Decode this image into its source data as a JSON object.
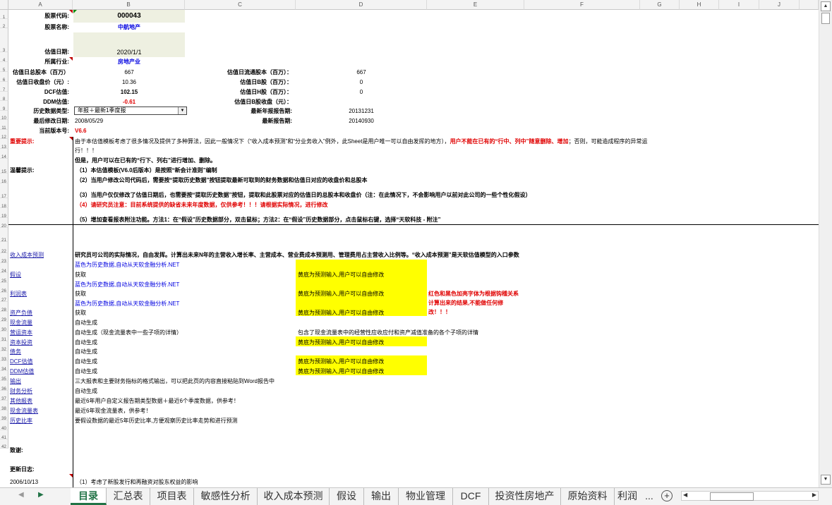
{
  "columns": [
    "A",
    "B",
    "C",
    "D",
    "E",
    "F",
    "G",
    "H",
    "I",
    "J"
  ],
  "rows": [
    "1",
    "2",
    "3",
    "4",
    "5",
    "6",
    "7",
    "8",
    "9",
    "10",
    "11",
    "12",
    "13",
    "14",
    "15",
    "16",
    "17",
    "18",
    "19",
    "20",
    "21",
    "22",
    "23",
    "24",
    "25",
    "26",
    "27",
    "28",
    "29",
    "30",
    "31",
    "32",
    "33",
    "34",
    "35",
    "36",
    "37",
    "38",
    "39",
    "40",
    "41",
    "42"
  ],
  "info": {
    "stock_code_label": "股票代码:",
    "stock_code": "000043",
    "stock_name_label": "股票名称:",
    "stock_name": "中航地产",
    "valuation_date_label": "估值日期:",
    "valuation_date": "2020/1/1",
    "industry_label": "所属行业:",
    "industry": "房地产业",
    "total_shares_label": "估值日总股本（百万）",
    "total_shares": "667",
    "float_shares_label": "估值日流通股本（百万）：",
    "float_shares": "667",
    "close_price_label": "估值日收盘价（元）:",
    "close_price": "10.36",
    "b_shares_label": "估值日B股（百万）：",
    "b_shares": "0",
    "dcf_label": "DCF估值:",
    "dcf_value": "102.15",
    "h_shares_label": "估值日H股（百万）：",
    "h_shares": "0",
    "ddm_label": "DDM估值:",
    "ddm_value": "-0.61",
    "b_close_label": "估值日B股收盘（元）：",
    "history_type_label": "历史数据类型:",
    "history_type": "年报＋最新1季度报",
    "latest_annual_label": "最新年报报告期:",
    "latest_annual": "20131231",
    "last_modified_label": "最后修改日期:",
    "last_modified": "2008/05/29",
    "latest_report_label": "最新报告期:",
    "latest_report": "20140930",
    "version_label": "当前版本号:",
    "version": "V6.6"
  },
  "notice": {
    "important_label": "重要提示:",
    "important_text_1": "由于本估值模板考虑了很多情况及提供了多种算法，因此一般情况下（“收入成本预测”和“分业务收入”例外，此Sheet是用户唯一可以自由发挥的地方），",
    "important_text_red": "用户不能在已有的“行中、列中”随意删除、增加",
    "important_text_2": "；否则，可能造成程序的异常运",
    "important_text_3": "行！！！",
    "important_text_4": "但是，用户可以在已有的“行下、列右”进行增加、删除。",
    "warm_label": "温馨提示:",
    "warm_1": "（1）本估值模板(V6.0后版本）是按照“新会计准则”编制",
    "warm_2": "（2）当用户修改公司代码后，需要按“提取历史数据”按钮提取最新可取到的财务数据和估值日对应的收盘价和总股本",
    "warm_3": "（3）当用户仅仅修改了估值日期后，也需要按“提取历史数据”按钮，提取和此股票对应的估值日的总股本和收盘价（注：在此情况下，不会影响用户以前对此公司的一些个性化假设）",
    "warm_4": "（4）请研究员注意：目前系统提供的缺省未来年度数据，仅供参考！！！请根据实际情况，进行修改",
    "warm_5": "（5）增加查看报表附注功能。方法1：在“假设”历史数据部分，双击鼠标；方法2：在“假设”历史数据部分，点击鼠标右键，选择“天软科技 - 附注”"
  },
  "toc": [
    {
      "name": "收入成本预测",
      "desc": "研究员可公司的实际情况，自由发挥。计算出未来N年的主营收入增长率、主营成本、营业费成本预测用、管理费用占主营收入比例等。“收入成本预测”是天软估值模型的入口参数",
      "desc2": "蓝色为历史数据,自动从天软金融分析.NET"
    },
    {
      "name": "假设",
      "desc": "获取",
      "desc2": "蓝色为历史数据,自动从天软金融分析.NET",
      "yellow": "黄底为预测输入,用户可以自由修改"
    },
    {
      "name": "利润表",
      "desc": "获取",
      "desc2": "蓝色为历史数据,自动从天软金融分析.NET",
      "yellow": "黄底为预测输入,用户可以自由修改"
    },
    {
      "name": "资产负债",
      "desc": "获取",
      "yellow": "黄底为预测输入,用户可以自由修改"
    },
    {
      "name": "现金流量",
      "desc": "自动生成"
    },
    {
      "name": "营运资本",
      "desc": "自动生成（现金流量表中一些子项的详情）",
      "extra": "包含了现金流量表中的经营性应收应付和资产减值准备的各个子项的详情"
    },
    {
      "name": "资本投资",
      "desc": "自动生成",
      "yellow": "黄底为预测输入,用户可以自由修改"
    },
    {
      "name": "债务",
      "desc": "自动生成"
    },
    {
      "name": "DCF估值",
      "desc": "自动生成",
      "yellow": "黄底为预测输入,用户可以自由修改"
    },
    {
      "name": "DDM估值",
      "desc": "自动生成",
      "yellow": "黄底为预测输入,用户可以自由修改"
    },
    {
      "name": "输出",
      "desc": "三大报表和主要财务指标的格式输出，可以把此页的内容直接粘贴到Word报告中"
    },
    {
      "name": "财务分析",
      "desc": "自动生成"
    },
    {
      "name": "其他报表",
      "desc": "最近6年用户自定义报告期类型数据＋最近6个季度数据，供参考！"
    },
    {
      "name": "现金流量表",
      "desc": "最近6年现金流量表，供参考！"
    },
    {
      "name": "历史比率",
      "desc": "要假设数据的最近5年历史比率,方便观察历史比率走势和进行预测"
    }
  ],
  "red_note_1": "红色和黑色加亮字体为根据钩稽关系",
  "red_note_2": "计算出来的结果,不能做任何修",
  "red_note_3": "改！！！",
  "thanks_label": "致谢:",
  "changelog_label": "更新日志:",
  "changelog_date": "2006/10/13",
  "changelog_text": "（1）考虑了新股发行和再融资对股东权益的影响",
  "tabs": [
    "目录",
    "汇总表",
    "项目表",
    "敏感性分析",
    "收入成本预测",
    "假设",
    "输出",
    "物业管理",
    "DCF",
    "投资性房地产",
    "原始资料",
    "利润"
  ],
  "more_tabs": "...",
  "colors": {
    "accent": "#217346",
    "red": "#e00000",
    "blue": "#0000e0",
    "yellow": "#ffff00"
  }
}
